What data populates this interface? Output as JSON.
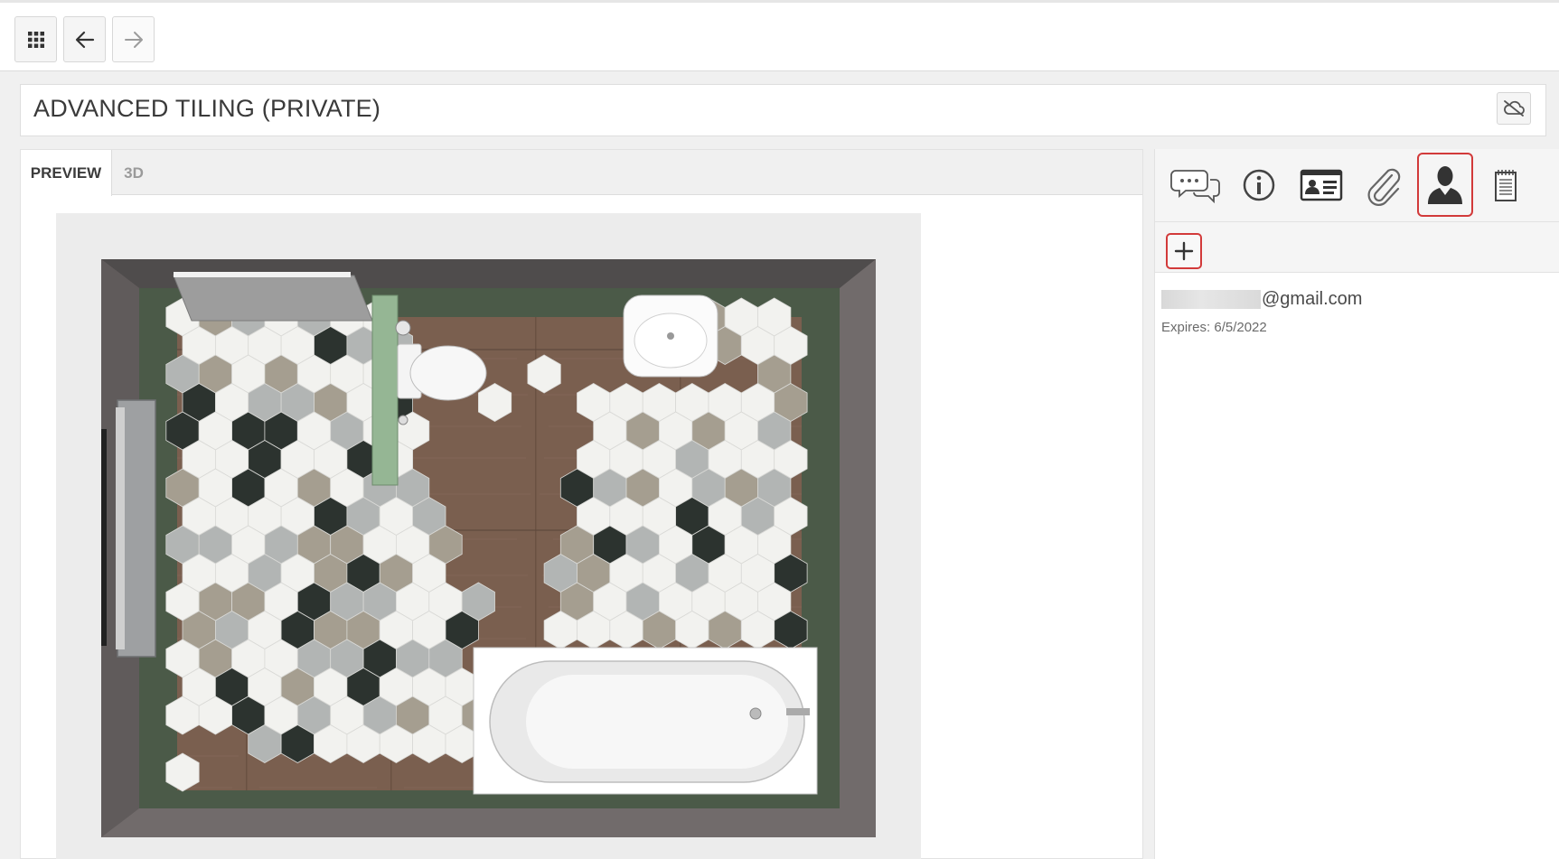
{
  "topbar": {
    "apps_icon": "apps-grid-icon",
    "back_icon": "arrow-left-icon",
    "forward_icon": "arrow-right-icon"
  },
  "project": {
    "title": "ADVANCED TILING (PRIVATE)",
    "cloud_icon": "cloud-off-icon"
  },
  "preview": {
    "tabs": [
      {
        "label": "PREVIEW",
        "active": true
      },
      {
        "label": "3D",
        "active": false
      }
    ]
  },
  "sidebar": {
    "tools": [
      {
        "icon": "comments-icon",
        "selected": false
      },
      {
        "icon": "info-icon",
        "selected": false
      },
      {
        "icon": "contact-card-icon",
        "selected": false
      },
      {
        "icon": "paperclip-icon",
        "selected": false
      },
      {
        "icon": "user-icon",
        "selected": true
      },
      {
        "icon": "notepad-icon",
        "selected": false
      }
    ],
    "add_icon": "plus-icon",
    "share": {
      "email_suffix": "@gmail.com",
      "expires": "Expires: 6/5/2022"
    }
  },
  "colors": {
    "accent_red": "#d23a3a",
    "floor_wood": "#7a5f4f",
    "wall_green": "#4b5a48",
    "tile_white": "#f2f2ef",
    "tile_black": "#2c332f",
    "tile_taupe": "#a59e90",
    "tile_grey": "#b2b5b4"
  }
}
